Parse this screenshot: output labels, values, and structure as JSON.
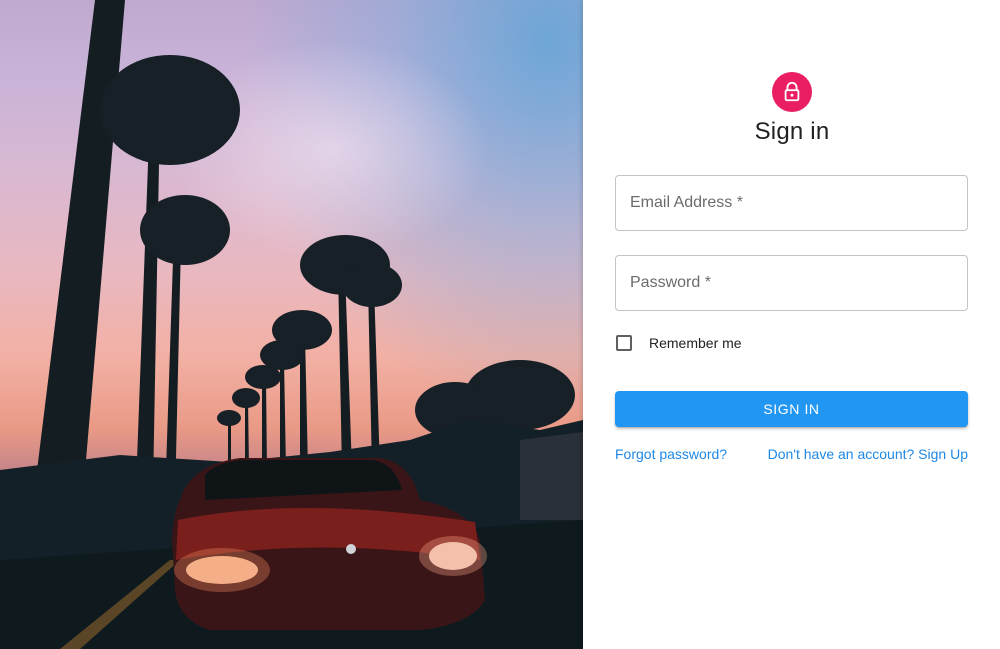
{
  "form": {
    "title": "Sign in",
    "email": {
      "label": "Email Address *",
      "value": ""
    },
    "password": {
      "label": "Password *",
      "value": ""
    },
    "remember_me": {
      "label": "Remember me",
      "checked": false
    },
    "submit_label": "SIGN IN",
    "forgot_link": "Forgot password?",
    "signup_link": "Don't have an account? Sign Up"
  },
  "icons": {
    "avatar": "lock-icon",
    "checkbox": "checkbox-unchecked-icon"
  },
  "colors": {
    "avatar_bg": "#e91e63",
    "primary": "#2196f3",
    "link": "#1e88e5",
    "text": "#212121",
    "border": "#c4c4c4"
  }
}
